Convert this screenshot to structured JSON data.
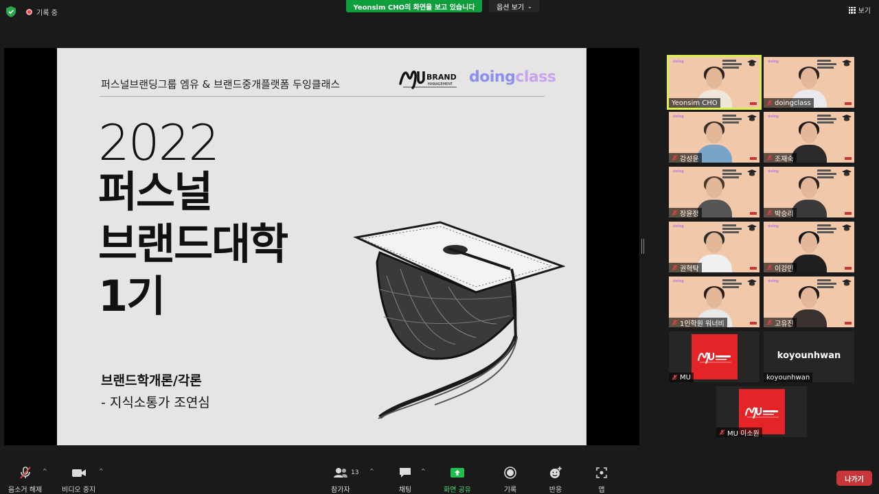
{
  "topbar": {
    "recording_label": "기록 중",
    "share_banner": "Yeonsim  CHO의 화면을 보고 있습니다",
    "options_label": "옵션 보기",
    "view_label": "보기"
  },
  "slide": {
    "header": "퍼스널브랜딩그룹 엠유 & 브랜드중개플랫폼 두잉클래스",
    "logo_mu_text": "BRAND",
    "logo_mu_sub": "MANAGEMENT",
    "logo_doing_a": "doing",
    "logo_doing_b": "class",
    "year": "2022",
    "title_line1": "퍼스널",
    "title_line2": "브랜드대학",
    "title_line3": "1기",
    "subtitle1": "브랜드학개론/각론",
    "subtitle2": "- 지식소통가 조연심"
  },
  "participants": [
    {
      "name": "Yeonsim CHO",
      "muted": false
    },
    {
      "name": "doingclass",
      "muted": true
    },
    {
      "name": "강성윤",
      "muted": true
    },
    {
      "name": "조재숙",
      "muted": true
    },
    {
      "name": "장윤정",
      "muted": true
    },
    {
      "name": "박승리",
      "muted": true
    },
    {
      "name": "권혁탁",
      "muted": true
    },
    {
      "name": "이강민",
      "muted": true
    },
    {
      "name": "1인학원 워너비",
      "muted": true
    },
    {
      "name": "고유진",
      "muted": true
    },
    {
      "name": "MU",
      "muted": true
    },
    {
      "name": "koyounhwan",
      "muted": false,
      "display_name": "koyounhwan"
    },
    {
      "name": "MU 이소원",
      "muted": true
    }
  ],
  "toolbar": {
    "audio_label": "음소거 해제",
    "video_label": "비디오 중지",
    "participants_label": "참가자",
    "participants_count": "13",
    "chat_label": "채팅",
    "share_label": "화면 공유",
    "record_label": "기록",
    "reaction_label": "반응",
    "apps_label": "앱",
    "leave_label": "나가기"
  },
  "colors": {
    "share_banner": "#0e9f3c",
    "active_speaker": "#d9ef4f",
    "leave": "#c8363a",
    "mu_brand": "#e52427"
  }
}
